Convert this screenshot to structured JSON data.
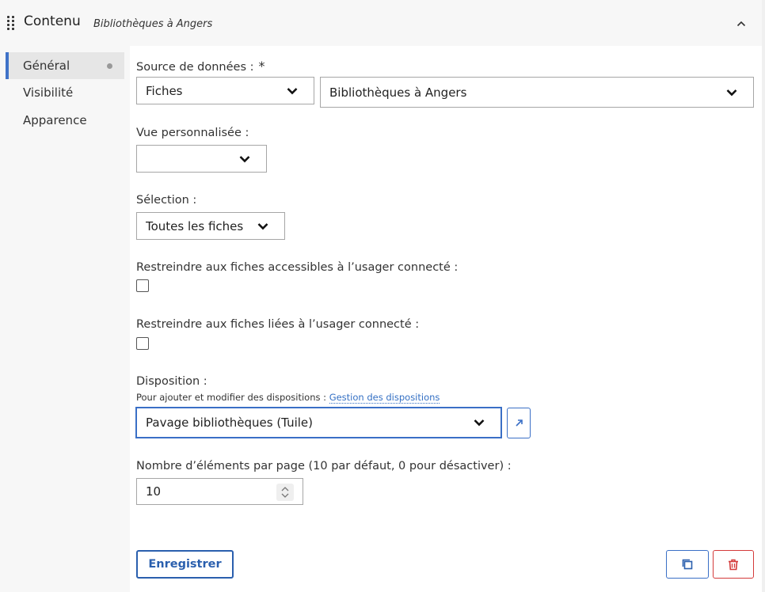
{
  "header": {
    "title": "Contenu",
    "subtitle": "Bibliothèques à Angers",
    "drag_icon": "drag-handle-icon",
    "collapse_icon": "chevron-up-icon"
  },
  "sidebar": {
    "items": [
      {
        "label": "Général",
        "active": true
      },
      {
        "label": "Visibilité",
        "active": false
      },
      {
        "label": "Apparence",
        "active": false
      }
    ]
  },
  "form": {
    "source": {
      "label": "Source de données :",
      "required_mark": "*",
      "type_value": "Fiches",
      "source_value": "Bibliothèques à Angers"
    },
    "custom_view": {
      "label": "Vue personnalisée :",
      "value": ""
    },
    "selection": {
      "label": "Sélection :",
      "value": "Toutes les fiches"
    },
    "restrict_accessible": {
      "label": "Restreindre aux fiches accessibles à l’usager connecté :",
      "checked": false
    },
    "restrict_linked": {
      "label": "Restreindre aux fiches liées à l’usager connecté :",
      "checked": false
    },
    "disposition": {
      "label": "Disposition :",
      "help_text": "Pour ajouter et modifier des dispositions :",
      "help_link": "Gestion des dispositions",
      "value": "Pavage bibliothèques (Tuile)",
      "open_icon": "external-link-icon"
    },
    "items_per_page": {
      "label": "Nombre d’éléments par page (10 par défaut, 0 pour désactiver) :",
      "value": "10"
    }
  },
  "footer": {
    "save_label": "Enregistrer",
    "duplicate_icon": "duplicate-icon",
    "delete_icon": "trash-icon"
  },
  "colors": {
    "accent": "#3a6fc6",
    "danger": "#d43a3a",
    "panel_bg": "#f7f7f7"
  }
}
